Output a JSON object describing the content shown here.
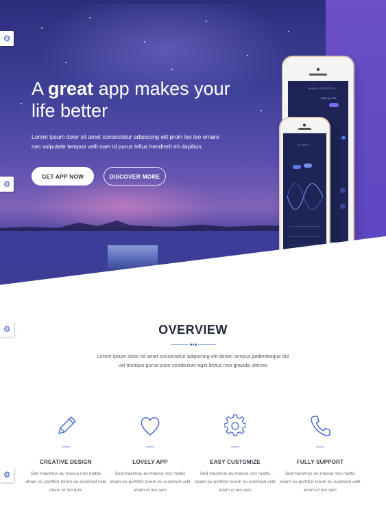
{
  "hero": {
    "title_prefix": "A ",
    "title_bold": "great",
    "title_suffix": " app makes your life better",
    "text": "Lorem ipsum dolor sit amet consectetur adipiscing elit proin leo leo ornare nec vulputate tempus velit nam id purus tellus hendrerit mi dapibus.",
    "buttons": {
      "get_app": "GET APP NOW",
      "discover": "DISCOVER MORE"
    }
  },
  "side_tabs": {
    "icon": "gear-icon"
  },
  "phone": {
    "back_screen_title": "MAIN SCREEN",
    "back_screen_label": "Dummy Text",
    "front_screen_title": "LIGHT"
  },
  "overview": {
    "title": "OVERVIEW",
    "text": "Lorem ipsum dolor sit amet consectetur adipiscing elit donec tempus pellentesque dui vel tristique purus justo vestibulum eget lectus non gravida ultrices"
  },
  "features": [
    {
      "icon": "pencil-icon",
      "title": "CREATIVE DESIGN",
      "text": "Sed maximus eu massa non mattis etiam eu porttitor lorem eu euismod velit etiam et leo quis"
    },
    {
      "icon": "heart-icon",
      "title": "LOVELY APP",
      "text": "Sed maximus eu massa non mattis etiam eu porttitor lorem eu euismod velit etiam et leo quis"
    },
    {
      "icon": "gear-icon",
      "title": "EASY CUSTOMIZE",
      "text": "Sed maximus eu massa non mattis etiam eu porttitor lorem eu euismod velit etiam et leo quis"
    },
    {
      "icon": "phone-icon",
      "title": "FULLY SUPPORT",
      "text": "Sed maximus eu massa non mattis etiam eu porttitor lorem eu euismod velit etiam et leo quis"
    }
  ],
  "colors": {
    "accent": "#3c63d6",
    "hero_right": "#5c45c0",
    "hero_dark": "#2c2f7c"
  }
}
